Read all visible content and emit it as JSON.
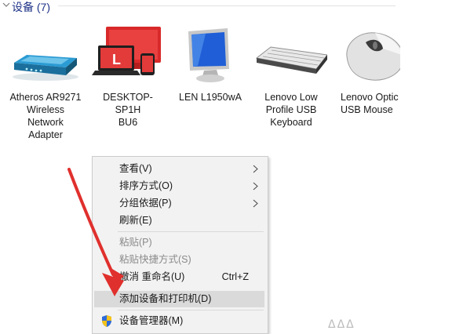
{
  "group": {
    "title": "设备 (7)"
  },
  "devices": [
    {
      "label": "Atheros AR9271\nWireless\nNetwork\nAdapter",
      "icon": "router-icon"
    },
    {
      "label": "DESKTOP-SP1H\nBU6",
      "icon": "computer-icon"
    },
    {
      "label": "LEN L1950wA",
      "icon": "monitor-icon"
    },
    {
      "label": "Lenovo Low\nProfile USB\nKeyboard",
      "icon": "keyboard-icon"
    },
    {
      "label": "Lenovo Optic\nUSB Mouse",
      "icon": "mouse-icon"
    }
  ],
  "context_menu": {
    "items": [
      {
        "label": "查看(V)",
        "submenu": true
      },
      {
        "label": "排序方式(O)",
        "submenu": true
      },
      {
        "label": "分组依据(P)",
        "submenu": true
      },
      {
        "label": "刷新(E)"
      },
      {
        "label": "粘贴(P)",
        "disabled": true
      },
      {
        "label": "粘贴快捷方式(S)",
        "disabled": true
      },
      {
        "label": "撤消 重命名(U)",
        "shortcut": "Ctrl+Z"
      },
      {
        "label": "添加设备和打印机(D)",
        "highlighted": true
      },
      {
        "label": "设备管理器(M)",
        "icon": "shield-icon"
      }
    ]
  },
  "colors": {
    "group_title": "#1e3287",
    "annotation_arrow": "#e0302d",
    "menu_bg": "#f2f2f2",
    "menu_highlight": "#dadada"
  }
}
